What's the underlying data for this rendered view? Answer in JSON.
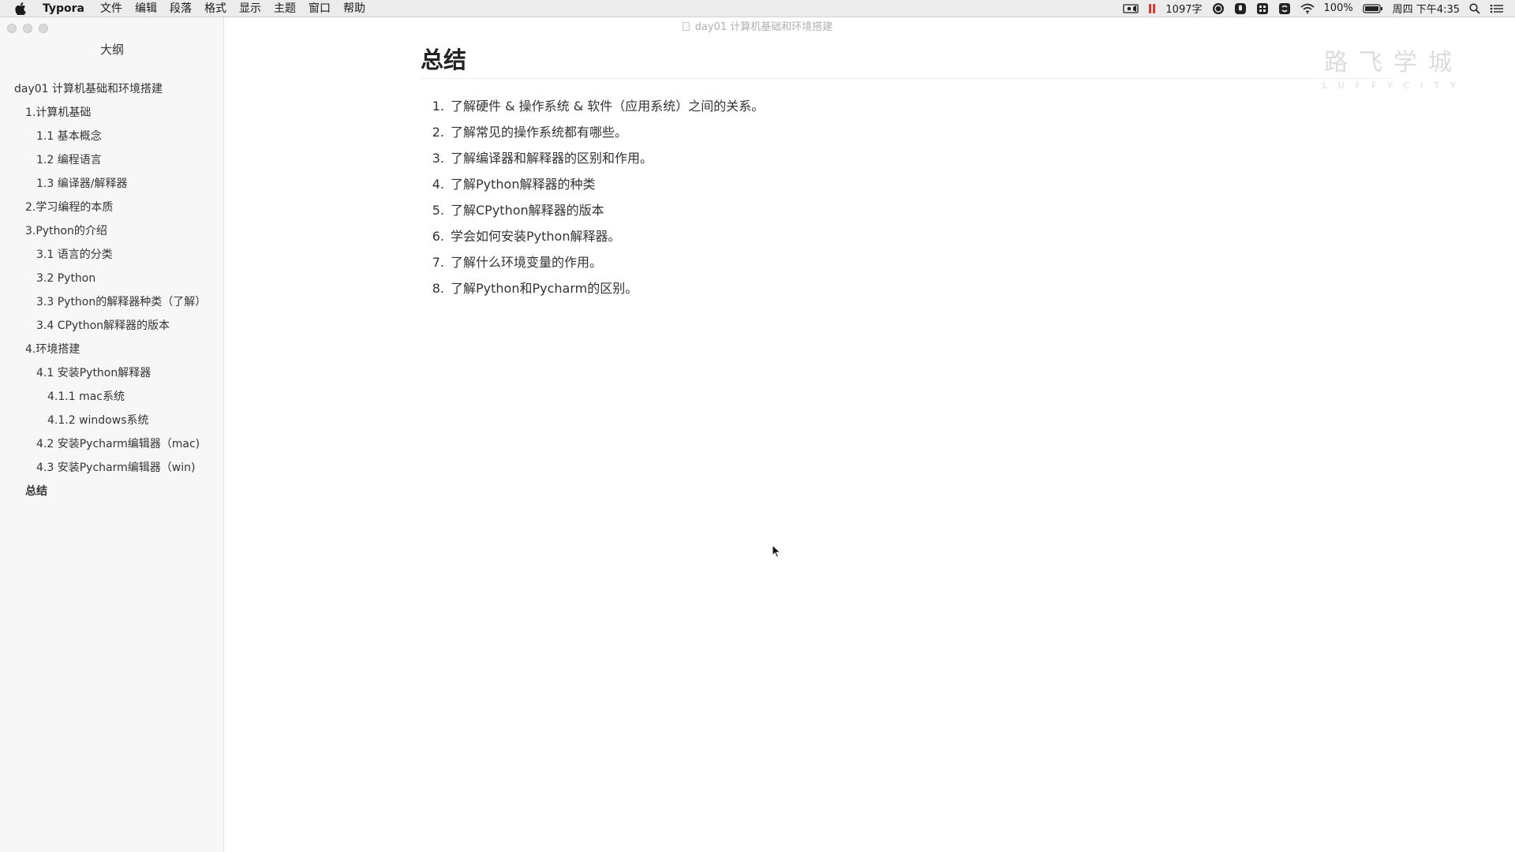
{
  "menubar": {
    "app_name": "Typora",
    "items": [
      "文件",
      "编辑",
      "段落",
      "格式",
      "显示",
      "主题",
      "窗口",
      "帮助"
    ],
    "word_count": "1097字",
    "battery": "100%",
    "clock": "周四 下午4:35"
  },
  "window": {
    "doc_title": "day01 计算机基础和环境搭建"
  },
  "sidebar": {
    "title": "大纲",
    "outline": [
      {
        "label": "day01 计算机基础和环境搭建",
        "level": 1
      },
      {
        "label": "1.计算机基础",
        "level": 2
      },
      {
        "label": "1.1 基本概念",
        "level": 3
      },
      {
        "label": "1.2 编程语言",
        "level": 3
      },
      {
        "label": "1.3 编译器/解释器",
        "level": 3
      },
      {
        "label": "2.学习编程的本质",
        "level": 2
      },
      {
        "label": "3.Python的介绍",
        "level": 2
      },
      {
        "label": "3.1 语言的分类",
        "level": 3
      },
      {
        "label": "3.2 Python",
        "level": 3
      },
      {
        "label": "3.3 Python的解释器种类（了解）",
        "level": 3
      },
      {
        "label": "3.4 CPython解释器的版本",
        "level": 3
      },
      {
        "label": "4.环境搭建",
        "level": 2
      },
      {
        "label": "4.1 安装Python解释器",
        "level": 3
      },
      {
        "label": "4.1.1 mac系统",
        "level": 4
      },
      {
        "label": "4.1.2 windows系统",
        "level": 4
      },
      {
        "label": "4.2 安装Pycharm编辑器（mac)",
        "level": 3
      },
      {
        "label": "4.3 安装Pycharm编辑器（win)",
        "level": 3
      },
      {
        "label": "总结",
        "level": 2,
        "active": true
      }
    ]
  },
  "editor": {
    "heading": "总结",
    "items": [
      {
        "num": "1.",
        "text": "了解硬件 & 操作系统 & 软件（应用系统）之间的关系。"
      },
      {
        "num": "2.",
        "text": "了解常见的操作系统都有哪些。"
      },
      {
        "num": "3.",
        "text": "了解编译器和解释器的区别和作用。"
      },
      {
        "num": "4.",
        "text": "了解Python解释器的种类"
      },
      {
        "num": "5.",
        "text": "了解CPython解释器的版本"
      },
      {
        "num": "6.",
        "text": "学会如何安装Python解释器。"
      },
      {
        "num": "7.",
        "text": "了解什么环境变量的作用。"
      },
      {
        "num": "8.",
        "text": "了解Python和Pycharm的区别。"
      }
    ]
  },
  "watermark": {
    "cn": "路飞学城",
    "en": "LUFFYCITY"
  }
}
